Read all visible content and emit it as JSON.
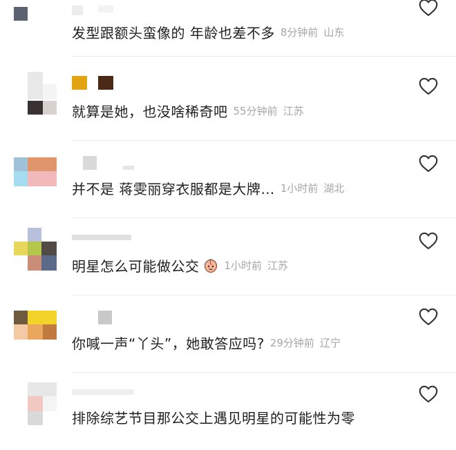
{
  "comments": [
    {
      "text": "发型跟额头蛮像的  年龄也差不多",
      "time": "8分钟前",
      "location": "山东",
      "avatar_colors": [
        "#5d6270",
        "#ffffff",
        "#ffffff",
        "#ffffff"
      ],
      "username_colors": [
        "#ececec",
        "#f3f3f3"
      ]
    },
    {
      "text": "就算是她，也没啥稀奇吧",
      "time": "55分钟前",
      "location": "江苏",
      "avatar_colors": [
        "#e8e8e8",
        "#f4f4f4",
        "#3a3230",
        "#d8d2cf"
      ],
      "username_colors": [
        "#e3a414",
        "#4a2a17"
      ]
    },
    {
      "text": "并不是  蒋雯丽穿衣服都是大牌…",
      "time": "1小时前",
      "location": "湖北",
      "avatar_colors": [
        "#9fc2d8",
        "#e1956a",
        "#a6dcf0",
        "#f1b9b9"
      ],
      "username_colors": [
        "#d9d9d9",
        "#e6e6e6"
      ]
    },
    {
      "text": "明星怎么可能做公交",
      "time": "1小时前",
      "location": "江苏",
      "avatar_colors": [
        "#e9d65d",
        "#534a45",
        "#c98d78",
        "#5a6a88"
      ],
      "username_colors": [
        "#e1e1e1",
        "#e9e9e9"
      ],
      "emoji": "peach-face-emoji"
    },
    {
      "text": "你喊一声“丫头”，她敢答应吗?",
      "time": "29分钟前",
      "location": "辽宁",
      "avatar_colors": [
        "#6e5a3c",
        "#f1d329",
        "#e8a75c",
        "#c07a3e"
      ],
      "username_colors": [
        "#c9c9c9",
        "#ffffff"
      ]
    },
    {
      "text": "排除综艺节目那公交上遇见明星的可能性为零",
      "time": "",
      "location": "",
      "avatar_colors": [
        "#e7e7e7",
        "#f2c9c0",
        "#d9d9d9",
        "#f5f5f5"
      ],
      "username_colors": [
        "#eeeeee",
        "#f6f6f6"
      ]
    }
  ],
  "ui": {
    "like_icon": "heart-outline-icon",
    "accent_text": "#1f1f1f",
    "meta_text": "#a6a6a6"
  }
}
